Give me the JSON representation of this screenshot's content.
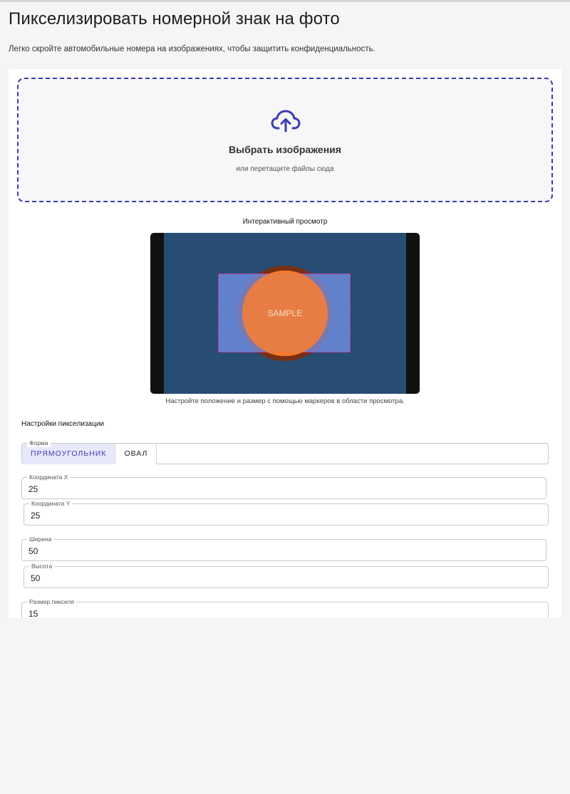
{
  "page": {
    "title": "Пикселизировать номерной знак на фото",
    "description": "Легко скройте автомобильные номера на изображениях, чтобы защитить конфиденциальность."
  },
  "upload": {
    "title": "Выбрать изображения",
    "subtitle": "или перетащите файлы сюда",
    "icon": "cloud-upload-icon"
  },
  "preview": {
    "title": "Интерактивный просмотр",
    "sample_label": "SAMPLE",
    "hint": "Настройте положение и размер с помощью маркеров в области просмотра."
  },
  "settings": {
    "title": "Настройки пикселизации",
    "shape": {
      "label": "Форма",
      "options": [
        "ПРЯМОУГОЛЬНИК",
        "ОВАЛ"
      ],
      "selected": "ПРЯМОУГОЛЬНИК"
    },
    "x": {
      "label": "Координата X",
      "value": "25"
    },
    "y": {
      "label": "Координата Y",
      "value": "25"
    },
    "width": {
      "label": "Ширина",
      "value": "50"
    },
    "height": {
      "label": "Высота",
      "value": "50"
    },
    "pixel_size": {
      "label": "Размер пикселя",
      "value": "15"
    }
  },
  "colors": {
    "accent": "#3b3bb5",
    "selection_border": "#e01a8a",
    "preview_bg": "#274d72",
    "sample_orange": "#f47a30"
  }
}
